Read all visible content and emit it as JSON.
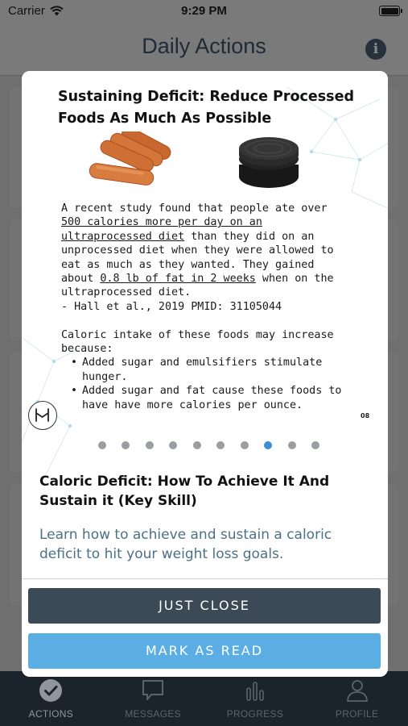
{
  "status_bar": {
    "carrier": "Carrier",
    "time": "9:29 PM",
    "wifi_icon": "wifi-icon",
    "battery_icon": "battery-icon"
  },
  "header": {
    "title": "Daily Actions",
    "info_icon": "info-icon",
    "info_glyph": "i"
  },
  "modal": {
    "slide": {
      "title_line1": "Sustaining Deficit: Reduce Processed",
      "title_line2": "Foods As Much As Possible",
      "images": [
        "sausages-image",
        "sandwich-cookie-image"
      ],
      "body": {
        "p1_l1": "A recent study found  that people ate over",
        "p1_l2": "500 calories more per day on an",
        "p1_l3a": "ultraprocessed diet",
        "p1_l3b": " than they did on an",
        "p1_l4": "unprocessed diet when they were allowed to",
        "p1_l5": "eat as much as they wanted. They gained",
        "p1_l6a": "about ",
        "p1_l6b": "0.8 lb of fat in 2 weeks",
        "p1_l6c": " when on the",
        "p1_l7": "ultraprocessed diet.",
        "citation": "- Hall et al., 2019 PMID: 31105044",
        "p2_l1": "Caloric intake of these foods may increase",
        "p2_l2": "because:",
        "bullets": [
          {
            "l1": "Added sugar and emulsifiers stimulate",
            "l2": "hunger."
          },
          {
            "l1": "Added sugar and fat cause these foods to",
            "l2": "have have more calories per ounce."
          }
        ]
      },
      "logo_icon": "brand-logo-icon",
      "slide_number": "08"
    },
    "pagination": {
      "total": 10,
      "current": 8
    },
    "lesson_title": "Caloric Deficit: How To Achieve It And Sustain it (Key Skill)",
    "lesson_description": "Learn how  to achieve and sustain a caloric deficit to hit your weight loss goals.",
    "buttons": {
      "close_label": "JUST CLOSE",
      "mark_read_label": "MARK AS READ"
    },
    "colors": {
      "close_button": "#3b4a56",
      "mark_read_button": "#5aaee4",
      "active_dot": "#3d8fd4",
      "description_text": "#4b7186"
    }
  },
  "tab_bar": {
    "tabs": [
      {
        "label": "ACTIONS",
        "icon": "check-circle-icon",
        "active": true
      },
      {
        "label": "MESSAGES",
        "icon": "chat-bubble-icon",
        "active": false
      },
      {
        "label": "PROGRESS",
        "icon": "bar-chart-icon",
        "active": false
      },
      {
        "label": "PROFILE",
        "icon": "person-icon",
        "active": false
      }
    ]
  }
}
